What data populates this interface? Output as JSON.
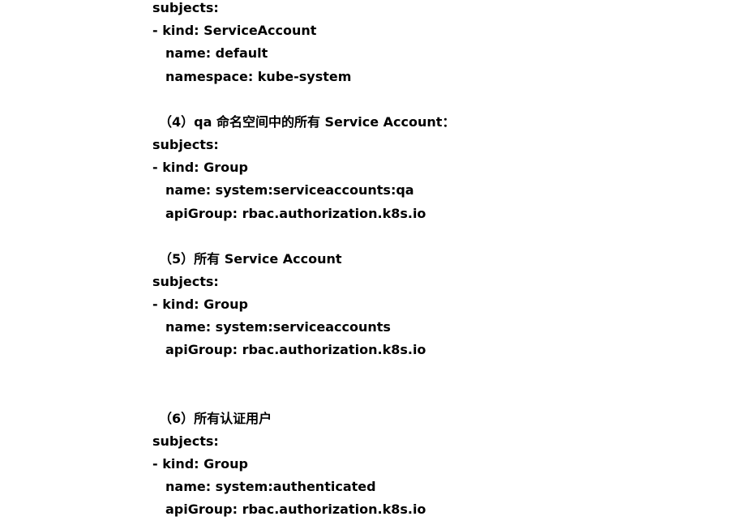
{
  "blocks": [
    {
      "subjects": "subjects:",
      "kind": "- kind: ServiceAccount",
      "name": "name: default",
      "extra": "namespace: kube-system"
    },
    {
      "heading": "（4）qa 命名空间中的所有 Service Account：",
      "subjects": "subjects:",
      "kind": "- kind: Group",
      "name": "name: system:serviceaccounts:qa",
      "extra": "apiGroup: rbac.authorization.k8s.io"
    },
    {
      "heading": "（5）所有 Service Account",
      "subjects": "subjects:",
      "kind": "- kind: Group",
      "name": "name: system:serviceaccounts",
      "extra": "apiGroup: rbac.authorization.k8s.io"
    },
    {
      "heading": "（6）所有认证用户",
      "subjects": "subjects:",
      "kind": "- kind: Group",
      "name": "name: system:authenticated",
      "extra": "apiGroup: rbac.authorization.k8s.io"
    }
  ]
}
